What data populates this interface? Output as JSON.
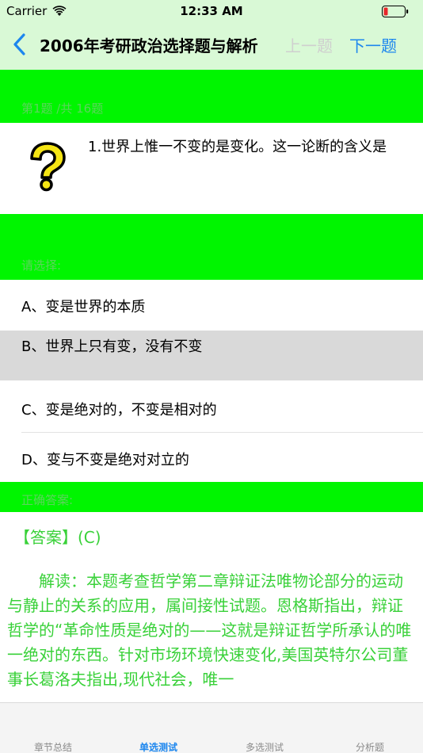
{
  "status": {
    "carrier": "Carrier",
    "time": "12:33 AM"
  },
  "nav": {
    "title": "2006年考研政治选择题与解析",
    "prev": "上一题",
    "next": "下一题"
  },
  "question": {
    "counter": "第1题 /共 16题",
    "text": "1.世界上惟一不变的是变化。这一论断的含义是"
  },
  "choose_label": "请选择:",
  "options": [
    {
      "label": "A、变是世界的本质",
      "selected": false
    },
    {
      "label": "B、世界上只有变，没有不变",
      "selected": true
    },
    {
      "label": "C、变是绝对的，不变是相对的",
      "selected": false
    },
    {
      "label": "D、变与不变是绝对对立的",
      "selected": false
    }
  ],
  "correct_label": "正确答案:",
  "answer": "【答案】(C)",
  "explanation": "解读：本题考查哲学第二章辩证法唯物论部分的运动与静止的关系的应用，属间接性试题。恩格斯指出，辩证哲学的“革命性质是绝对的——这就是辩证哲学所承认的唯一绝对的东西。针对市场环境快速变化,美国英特尔公司董事长葛洛夫指出,现代社会，唯一",
  "tabs": [
    {
      "label": "章节总结",
      "active": false
    },
    {
      "label": "单选测试",
      "active": true
    },
    {
      "label": "多选测试",
      "active": false
    },
    {
      "label": "分析题",
      "active": false
    }
  ],
  "colors": {
    "band": "#00f500",
    "nav_bg": "#d9f9d6",
    "accent": "#1c86ee",
    "answer_text": "#39d139"
  }
}
